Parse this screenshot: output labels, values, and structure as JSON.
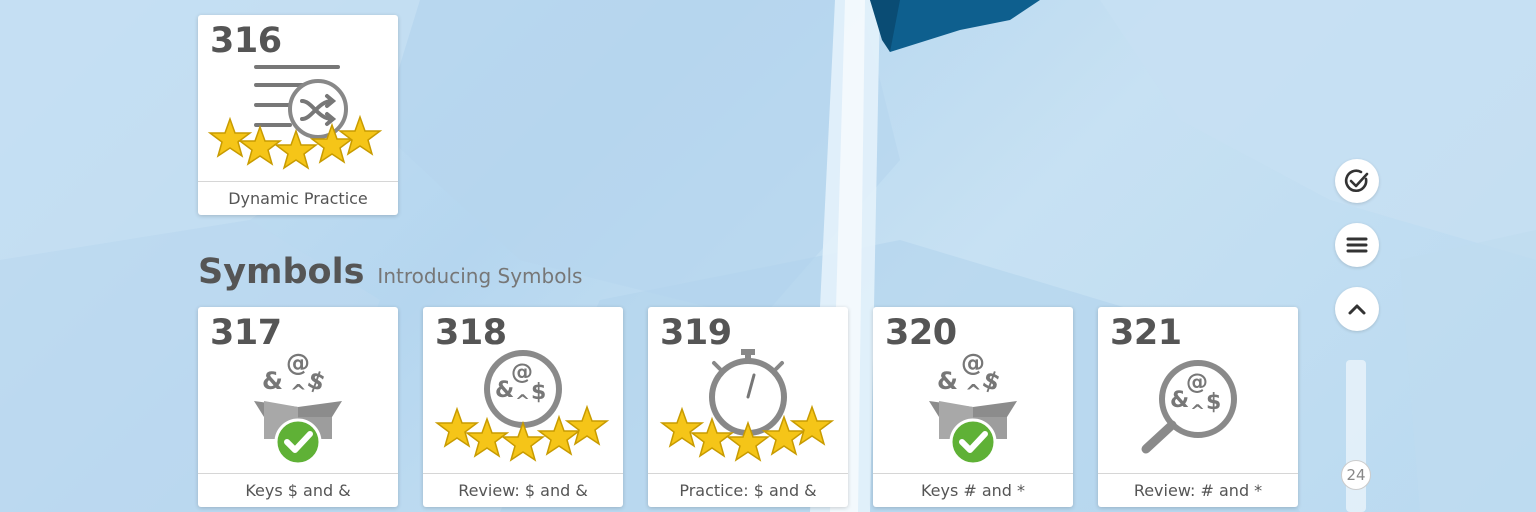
{
  "top_card": {
    "number": "316",
    "label": "Dynamic Practice",
    "icon": "dynamic-practice-shuffle-icon",
    "stars": 5
  },
  "section": {
    "title": "Symbols",
    "subtitle": "Introducing Symbols"
  },
  "cards": [
    {
      "number": "317",
      "label": "Keys $ and &",
      "icon": "symbols-box-icon",
      "completed": true
    },
    {
      "number": "318",
      "label": "Review: $ and &",
      "icon": "symbols-magnifier-icon",
      "stars": 5
    },
    {
      "number": "319",
      "label": "Practice: $ and &",
      "icon": "stopwatch-icon",
      "stars": 5
    },
    {
      "number": "320",
      "label": "Keys # and *",
      "icon": "symbols-box-icon",
      "completed": true
    },
    {
      "number": "321",
      "label": "Review: # and *",
      "icon": "symbols-magnifier-icon"
    }
  ],
  "side_controls": {
    "check_icon": "check-circle-icon",
    "menu_icon": "menu-icon",
    "up_icon": "chevron-up-icon",
    "scroll_value": "24"
  },
  "colors": {
    "star": "#f5c518",
    "check_green": "#5fb136",
    "icon_gray": "#777777",
    "text_gray": "#555555"
  }
}
